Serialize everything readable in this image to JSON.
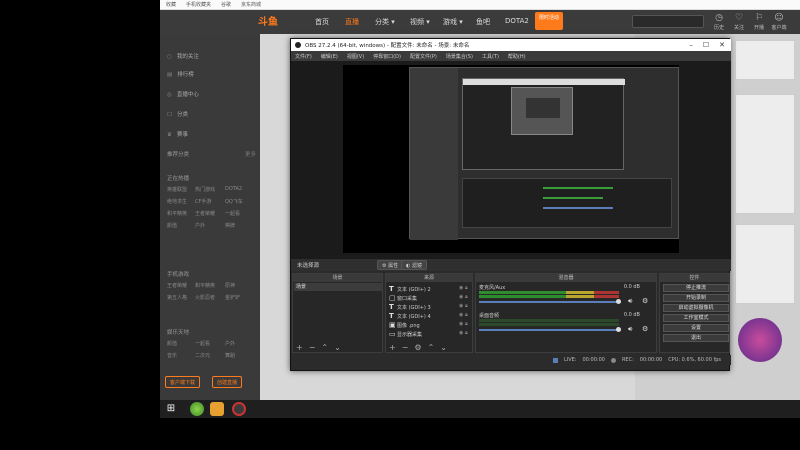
{
  "bookmarks": [
    "收藏",
    "手机收藏夹",
    "谷歌",
    "京东商城"
  ],
  "site": {
    "logo": "斗鱼",
    "nav": [
      "首页",
      "直播",
      "分类 ▾",
      "视频 ▾",
      "游戏 ▾",
      "鱼吧",
      "DOTA2"
    ],
    "nav_hot": "限时活动",
    "header_icons": [
      {
        "icon": "clock-icon",
        "label": "历史"
      },
      {
        "icon": "heart-icon",
        "label": "关注"
      },
      {
        "icon": "gift-icon",
        "label": "开播"
      },
      {
        "icon": "user-icon",
        "label": "客户端"
      }
    ],
    "sidebar": {
      "items": [
        {
          "icon": "○",
          "label": "我的关注"
        },
        {
          "icon": "▤",
          "label": "排行榜"
        },
        {
          "icon": "◎",
          "label": "直播中心"
        },
        {
          "icon": "☐",
          "label": "分类"
        },
        {
          "icon": "♛",
          "label": "赛事"
        }
      ],
      "heading1": "推荐分类",
      "heading1_more": "更多",
      "sec1": "正在热播",
      "grid1": [
        "英雄联盟",
        "热门游戏",
        "DOTA2",
        "绝地求生",
        "CF手游",
        "QQ飞车",
        "和平精英",
        "王者荣耀",
        "一起看",
        "颜值",
        "户外",
        "棋牌"
      ],
      "sec2": "手机游戏",
      "grid2": [
        "王者荣耀",
        "和平精英",
        "原神",
        "第五人格",
        "火影忍者",
        "金铲铲"
      ],
      "sec3": "娱乐天地",
      "grid3": [
        "颜值",
        "一起看",
        "户外",
        "音乐",
        "二次元",
        "舞蹈"
      ],
      "btn_left": "客户端下载",
      "btn_right": "创建直播"
    }
  },
  "obs": {
    "title": "OBS 27.2.4 (64-bit, windows) - 配置文件: 未命名 - 场景: 未命名",
    "menu": [
      "文件(F)",
      "编辑(E)",
      "视图(V)",
      "停靠窗口(D)",
      "配置文件(P)",
      "场景集合(S)",
      "工具(T)",
      "帮助(H)"
    ],
    "no_source": "未选择源",
    "props_btn": "属性",
    "filter_btn": "滤镜",
    "docks": {
      "scenes_title": "场景",
      "sources_title": "来源",
      "mixer_title": "混音器",
      "controls_title": "控件"
    },
    "scenes": [
      "场景"
    ],
    "sources": [
      {
        "icon": "T",
        "label": "文本 (GDI+) 2"
      },
      {
        "icon": "▢",
        "label": "窗口采集"
      },
      {
        "icon": "T",
        "label": "文本 (GDI+) 3"
      },
      {
        "icon": "T",
        "label": "文本 (GDI+) 4"
      },
      {
        "icon": "▣",
        "label": "图像 .png"
      },
      {
        "icon": "▭",
        "label": "显示器采集"
      }
    ],
    "mixer": [
      {
        "name": "麦克风/Aux",
        "db": "0.0 dB"
      },
      {
        "name": "桌面音频",
        "db": "0.0 dB"
      }
    ],
    "controls": [
      "停止推流",
      "开始录制",
      "启动虚拟摄像机",
      "工作室模式",
      "设置",
      "退出"
    ],
    "status": {
      "live_label": "LIVE:",
      "live_time": "00:00:00",
      "rec_label": "REC:",
      "rec_time": "00:00:00",
      "cpu": "CPU: 0.6%, 60.00 fps"
    }
  },
  "colors": {
    "accent": "#ff7a1a",
    "obs_bg": "#2b2b2b"
  }
}
